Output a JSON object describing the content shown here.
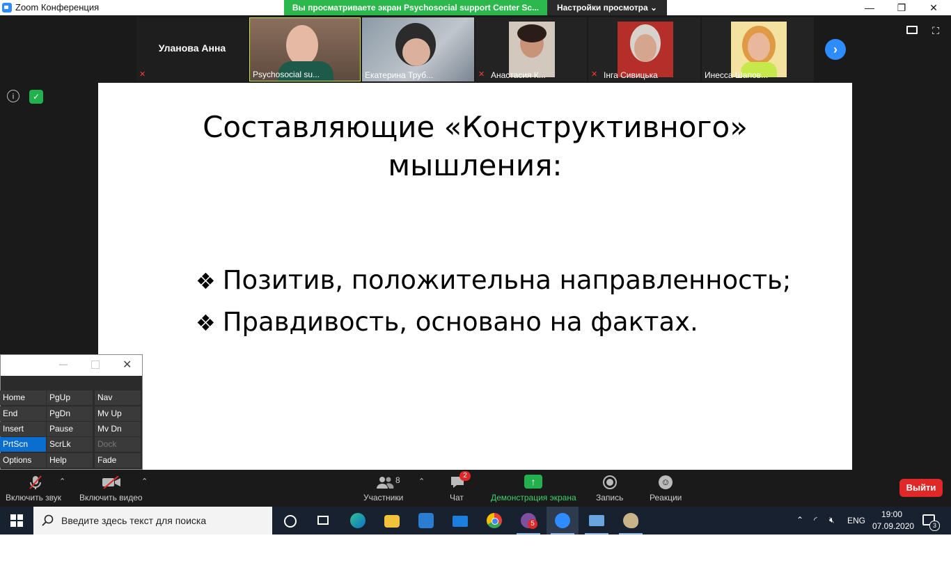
{
  "window": {
    "title": "Zoom Конференция",
    "minimize": "—",
    "maximize": "❐",
    "close": "✕"
  },
  "share_banner": "Вы просматриваете экран Psychosocial support Center Sc...",
  "view_options": "Настройки просмотра ⌄",
  "gallery": {
    "active_speaker": "Уланова Анна",
    "tiles": [
      {
        "name": "Psychosocial su...",
        "muted": false
      },
      {
        "name": "Екатерина Труб...",
        "muted": false
      },
      {
        "name": "Анастасия К...",
        "muted": true
      },
      {
        "name": "Інга Сивицька",
        "muted": true
      },
      {
        "name": "Инесса Шапов...",
        "muted": false
      }
    ]
  },
  "slide": {
    "title_line1": "Составляющие «Конструктивного»",
    "title_line2": "мышления:",
    "bullets": [
      "Позитив, положительна направленность;",
      "Правдивость, основано на фактах."
    ],
    "bullet_mark": "❖"
  },
  "osk": {
    "keys": [
      [
        "Home",
        "PgUp",
        "Nav"
      ],
      [
        "End",
        "PgDn",
        "Mv Up"
      ],
      [
        "Insert",
        "Pause",
        "Mv Dn"
      ],
      [
        "PrtScn",
        "ScrLk",
        "Dock"
      ],
      [
        "Options",
        "Help",
        "Fade"
      ]
    ],
    "highlighted": "PrtScn",
    "disabled": "Dock"
  },
  "toolbar": {
    "audio": "Включить звук",
    "video": "Включить видео",
    "participants": "Участники",
    "participants_count": "8",
    "chat": "Чат",
    "chat_badge": "2",
    "share": "Демонстрация экрана",
    "record": "Запись",
    "reactions": "Реакции",
    "leave": "Выйти"
  },
  "taskbar": {
    "search_placeholder": "Введите здесь текст для поиска",
    "viber_badge": "5",
    "lang": "ENG",
    "time": "19:00",
    "date": "07.09.2020",
    "notifications": "3"
  },
  "colors": {
    "zoom_blue": "#2d8cff",
    "share_green": "#2db84d",
    "leave_red": "#e02828",
    "taskbar": "#17212f"
  }
}
